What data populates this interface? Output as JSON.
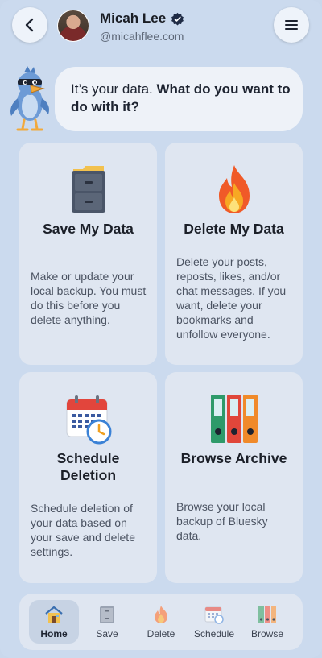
{
  "header": {
    "user_name": "Micah Lee",
    "handle": "@micahflee.com"
  },
  "bubble": {
    "text_plain": "It’s your data. ",
    "text_bold": "What do you want to do with it?"
  },
  "cards": [
    {
      "title": "Save My Data",
      "description": "Make or update your local backup. You must do this before you delete anything.",
      "icon": "filing-cabinet-icon"
    },
    {
      "title": "Delete My Data",
      "description": "Delete your posts, reposts, likes, and/or chat messages. If you want, delete your bookmarks and unfollow everyone.",
      "icon": "fire-icon"
    },
    {
      "title": "Schedule Deletion",
      "description": "Schedule deletion of your data based on your save and delete settings.",
      "icon": "calendar-clock-icon"
    },
    {
      "title": "Browse Archive",
      "description": "Browse your local backup of Bluesky data.",
      "icon": "binders-icon"
    }
  ],
  "nav": {
    "items": [
      {
        "label": "Home",
        "icon": "house-icon",
        "active": true
      },
      {
        "label": "Save",
        "icon": "filing-cabinet-icon",
        "active": false
      },
      {
        "label": "Delete",
        "icon": "fire-icon",
        "active": false
      },
      {
        "label": "Schedule",
        "icon": "calendar-icon",
        "active": false
      },
      {
        "label": "Browse",
        "icon": "binders-icon",
        "active": false
      }
    ]
  },
  "colors": {
    "background": "#cbdaee",
    "card": "#dfe6f1",
    "verified": "#1f2b45"
  }
}
